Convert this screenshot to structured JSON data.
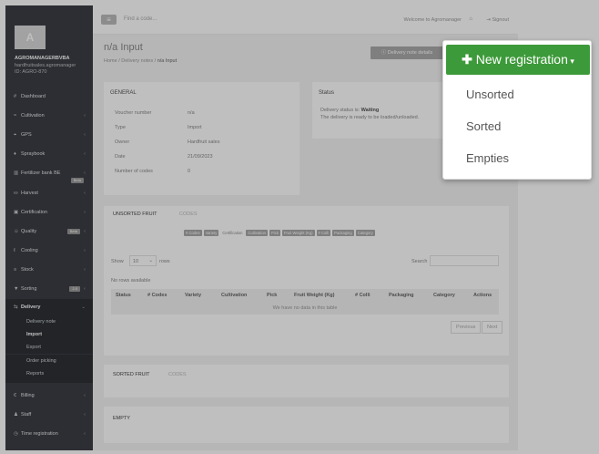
{
  "sidebar": {
    "avatar_letter": "A",
    "org_name": "AGROMANAGERBVBA",
    "org_sub": "hardfruitsales.agromanager",
    "org_id": "ID: AGRO-870",
    "items": [
      {
        "icon": "#",
        "label": "Dashboard"
      },
      {
        "icon": "≈",
        "label": "Cultivation"
      },
      {
        "icon": "⌖",
        "label": "GPS"
      },
      {
        "icon": "♦",
        "label": "Spraybook"
      },
      {
        "icon": "▥",
        "label": "Fertilizer bank BE",
        "badge": "Beta"
      },
      {
        "icon": "⛀",
        "label": "Harvest"
      },
      {
        "icon": "▣",
        "label": "Certification"
      },
      {
        "icon": "☺",
        "label": "Quality",
        "badge": "Beta"
      },
      {
        "icon": "ℓ",
        "label": "Cooling"
      },
      {
        "icon": "≡",
        "label": "Stock"
      },
      {
        "icon": "▼",
        "label": "Sorting",
        "badge": "2.0"
      },
      {
        "icon": "⇆",
        "label": "Delivery"
      },
      {
        "icon": "€",
        "label": "Billing"
      },
      {
        "icon": "♟",
        "label": "Staff"
      },
      {
        "icon": "◷",
        "label": "Time registration"
      }
    ],
    "delivery_sub": [
      "Delivery note",
      "Import",
      "Export",
      "Order picking",
      "Reports"
    ]
  },
  "topbar": {
    "menu_icon": "≡",
    "search_placeholder": "Find a code...",
    "welcome": "Welcome to Agromanager",
    "signout": "Signout"
  },
  "page": {
    "title": "n/a Input",
    "breadcrumb": [
      "Home",
      "Delivery notes",
      "n/a Input"
    ],
    "delivery_note_button": "Delivery note details"
  },
  "general": {
    "title": "GENERAL",
    "rows": [
      {
        "k": "Voucher number",
        "v": "n/a"
      },
      {
        "k": "Type",
        "v": "Import"
      },
      {
        "k": "Owner",
        "v": "Hardfruit sales"
      },
      {
        "k": "Date",
        "v": "21/09/2023"
      },
      {
        "k": "Number of codes",
        "v": "0"
      }
    ]
  },
  "status": {
    "title": "Status",
    "line1_prefix": "Delivery status is: ",
    "line1_value": "Waiting",
    "line2": "The delivery is ready to be loaded/unloaded."
  },
  "unsorted": {
    "tab_active": "UNSORTED FRUIT",
    "tab_inactive": "CODES",
    "column_toggles": [
      "# Codes",
      "Variety",
      "Certification",
      "Cultivation",
      "Pick",
      "Fruit Weight (Kg)",
      "# Colli",
      "Packaging",
      "Category"
    ],
    "show": "Show",
    "show_value": "10",
    "rows_label": "rows",
    "search_label": "Search",
    "no_rows": "No rows available",
    "headers": [
      "Status",
      "# Codes",
      "Variety",
      "Cultivation",
      "Pick",
      "Fruit Weight (Kg)",
      "# Colli",
      "Packaging",
      "Category",
      "Actions"
    ],
    "empty_text": "We have no data in this table",
    "prev": "Previous",
    "next": "Next"
  },
  "sorted": {
    "tab_active": "SORTED FRUIT",
    "tab_inactive": "CODES"
  },
  "empty_section": {
    "tab_active": "EMPTY"
  },
  "dropdown": {
    "button_label": "New registration",
    "items": [
      "Unsorted",
      "Sorted",
      "Empties"
    ]
  }
}
